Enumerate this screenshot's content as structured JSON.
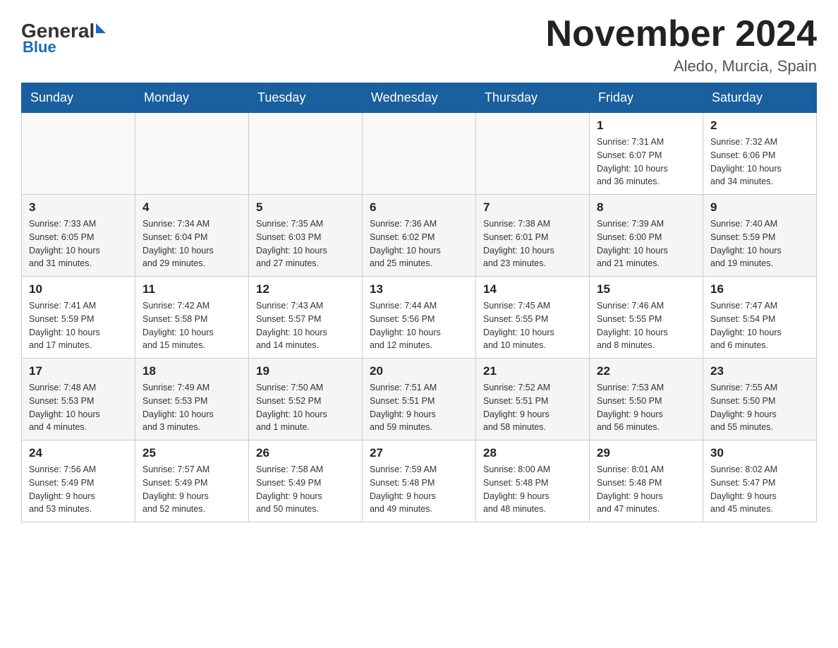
{
  "header": {
    "logo_general": "General",
    "logo_blue": "Blue",
    "title": "November 2024",
    "location": "Aledo, Murcia, Spain"
  },
  "days_of_week": [
    "Sunday",
    "Monday",
    "Tuesday",
    "Wednesday",
    "Thursday",
    "Friday",
    "Saturday"
  ],
  "weeks": [
    {
      "days": [
        {
          "num": "",
          "info": ""
        },
        {
          "num": "",
          "info": ""
        },
        {
          "num": "",
          "info": ""
        },
        {
          "num": "",
          "info": ""
        },
        {
          "num": "",
          "info": ""
        },
        {
          "num": "1",
          "info": "Sunrise: 7:31 AM\nSunset: 6:07 PM\nDaylight: 10 hours\nand 36 minutes."
        },
        {
          "num": "2",
          "info": "Sunrise: 7:32 AM\nSunset: 6:06 PM\nDaylight: 10 hours\nand 34 minutes."
        }
      ]
    },
    {
      "days": [
        {
          "num": "3",
          "info": "Sunrise: 7:33 AM\nSunset: 6:05 PM\nDaylight: 10 hours\nand 31 minutes."
        },
        {
          "num": "4",
          "info": "Sunrise: 7:34 AM\nSunset: 6:04 PM\nDaylight: 10 hours\nand 29 minutes."
        },
        {
          "num": "5",
          "info": "Sunrise: 7:35 AM\nSunset: 6:03 PM\nDaylight: 10 hours\nand 27 minutes."
        },
        {
          "num": "6",
          "info": "Sunrise: 7:36 AM\nSunset: 6:02 PM\nDaylight: 10 hours\nand 25 minutes."
        },
        {
          "num": "7",
          "info": "Sunrise: 7:38 AM\nSunset: 6:01 PM\nDaylight: 10 hours\nand 23 minutes."
        },
        {
          "num": "8",
          "info": "Sunrise: 7:39 AM\nSunset: 6:00 PM\nDaylight: 10 hours\nand 21 minutes."
        },
        {
          "num": "9",
          "info": "Sunrise: 7:40 AM\nSunset: 5:59 PM\nDaylight: 10 hours\nand 19 minutes."
        }
      ]
    },
    {
      "days": [
        {
          "num": "10",
          "info": "Sunrise: 7:41 AM\nSunset: 5:59 PM\nDaylight: 10 hours\nand 17 minutes."
        },
        {
          "num": "11",
          "info": "Sunrise: 7:42 AM\nSunset: 5:58 PM\nDaylight: 10 hours\nand 15 minutes."
        },
        {
          "num": "12",
          "info": "Sunrise: 7:43 AM\nSunset: 5:57 PM\nDaylight: 10 hours\nand 14 minutes."
        },
        {
          "num": "13",
          "info": "Sunrise: 7:44 AM\nSunset: 5:56 PM\nDaylight: 10 hours\nand 12 minutes."
        },
        {
          "num": "14",
          "info": "Sunrise: 7:45 AM\nSunset: 5:55 PM\nDaylight: 10 hours\nand 10 minutes."
        },
        {
          "num": "15",
          "info": "Sunrise: 7:46 AM\nSunset: 5:55 PM\nDaylight: 10 hours\nand 8 minutes."
        },
        {
          "num": "16",
          "info": "Sunrise: 7:47 AM\nSunset: 5:54 PM\nDaylight: 10 hours\nand 6 minutes."
        }
      ]
    },
    {
      "days": [
        {
          "num": "17",
          "info": "Sunrise: 7:48 AM\nSunset: 5:53 PM\nDaylight: 10 hours\nand 4 minutes."
        },
        {
          "num": "18",
          "info": "Sunrise: 7:49 AM\nSunset: 5:53 PM\nDaylight: 10 hours\nand 3 minutes."
        },
        {
          "num": "19",
          "info": "Sunrise: 7:50 AM\nSunset: 5:52 PM\nDaylight: 10 hours\nand 1 minute."
        },
        {
          "num": "20",
          "info": "Sunrise: 7:51 AM\nSunset: 5:51 PM\nDaylight: 9 hours\nand 59 minutes."
        },
        {
          "num": "21",
          "info": "Sunrise: 7:52 AM\nSunset: 5:51 PM\nDaylight: 9 hours\nand 58 minutes."
        },
        {
          "num": "22",
          "info": "Sunrise: 7:53 AM\nSunset: 5:50 PM\nDaylight: 9 hours\nand 56 minutes."
        },
        {
          "num": "23",
          "info": "Sunrise: 7:55 AM\nSunset: 5:50 PM\nDaylight: 9 hours\nand 55 minutes."
        }
      ]
    },
    {
      "days": [
        {
          "num": "24",
          "info": "Sunrise: 7:56 AM\nSunset: 5:49 PM\nDaylight: 9 hours\nand 53 minutes."
        },
        {
          "num": "25",
          "info": "Sunrise: 7:57 AM\nSunset: 5:49 PM\nDaylight: 9 hours\nand 52 minutes."
        },
        {
          "num": "26",
          "info": "Sunrise: 7:58 AM\nSunset: 5:49 PM\nDaylight: 9 hours\nand 50 minutes."
        },
        {
          "num": "27",
          "info": "Sunrise: 7:59 AM\nSunset: 5:48 PM\nDaylight: 9 hours\nand 49 minutes."
        },
        {
          "num": "28",
          "info": "Sunrise: 8:00 AM\nSunset: 5:48 PM\nDaylight: 9 hours\nand 48 minutes."
        },
        {
          "num": "29",
          "info": "Sunrise: 8:01 AM\nSunset: 5:48 PM\nDaylight: 9 hours\nand 47 minutes."
        },
        {
          "num": "30",
          "info": "Sunrise: 8:02 AM\nSunset: 5:47 PM\nDaylight: 9 hours\nand 45 minutes."
        }
      ]
    }
  ]
}
